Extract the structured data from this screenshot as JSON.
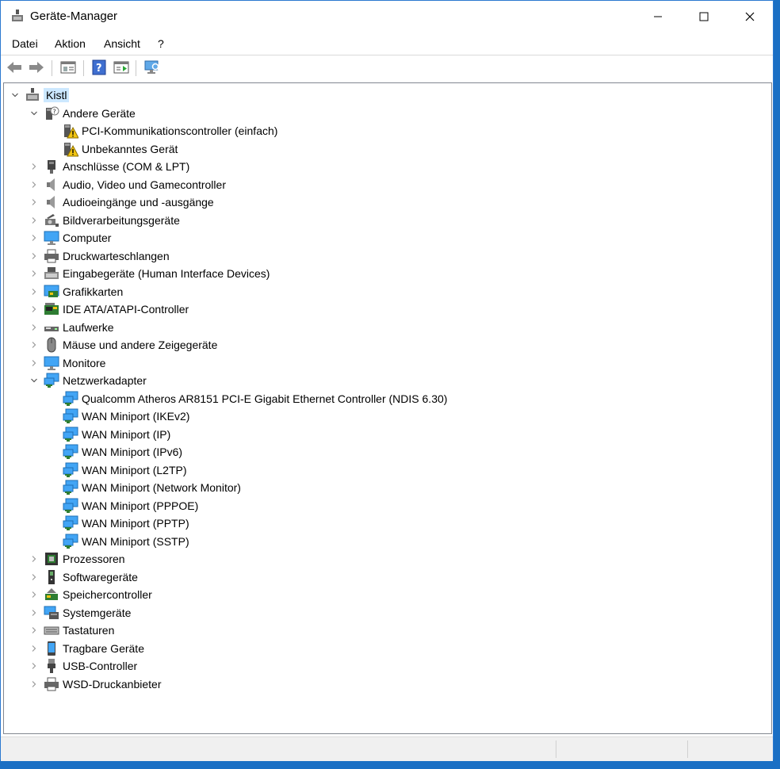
{
  "window": {
    "title": "Geräte-Manager"
  },
  "menu": [
    "Datei",
    "Aktion",
    "Ansicht",
    "?"
  ],
  "tree": {
    "root": "Kistl",
    "categories": [
      {
        "label": "Andere Geräte",
        "icon": "other-devices-icon",
        "expanded": true,
        "children": [
          "PCI-Kommunikationscontroller (einfach)",
          "Unbekanntes Gerät"
        ]
      },
      {
        "label": "Anschlüsse (COM & LPT)",
        "icon": "port-icon"
      },
      {
        "label": "Audio, Video und Gamecontroller",
        "icon": "speaker-icon"
      },
      {
        "label": "Audioeingänge und -ausgänge",
        "icon": "speaker-icon"
      },
      {
        "label": "Bildverarbeitungsgeräte",
        "icon": "camera-icon"
      },
      {
        "label": "Computer",
        "icon": "computer-icon"
      },
      {
        "label": "Druckwarteschlangen",
        "icon": "printer-icon"
      },
      {
        "label": "Eingabegeräte (Human Interface Devices)",
        "icon": "hid-icon"
      },
      {
        "label": "Grafikkarten",
        "icon": "display-adapter-icon"
      },
      {
        "label": "IDE ATA/ATAPI-Controller",
        "icon": "ide-controller-icon"
      },
      {
        "label": "Laufwerke",
        "icon": "disk-drive-icon"
      },
      {
        "label": "Mäuse und andere Zeigegeräte",
        "icon": "mouse-icon"
      },
      {
        "label": "Monitore",
        "icon": "monitor-icon"
      },
      {
        "label": "Netzwerkadapter",
        "icon": "network-adapter-icon",
        "expanded": true,
        "children": [
          "Qualcomm Atheros AR8151 PCI-E Gigabit Ethernet Controller (NDIS 6.30)",
          "WAN Miniport (IKEv2)",
          "WAN Miniport (IP)",
          "WAN Miniport (IPv6)",
          "WAN Miniport (L2TP)",
          "WAN Miniport (Network Monitor)",
          "WAN Miniport (PPPOE)",
          "WAN Miniport (PPTP)",
          "WAN Miniport (SSTP)"
        ]
      },
      {
        "label": "Prozessoren",
        "icon": "processor-icon"
      },
      {
        "label": "Softwaregeräte",
        "icon": "software-device-icon"
      },
      {
        "label": "Speichercontroller",
        "icon": "storage-controller-icon"
      },
      {
        "label": "Systemgeräte",
        "icon": "system-device-icon"
      },
      {
        "label": "Tastaturen",
        "icon": "keyboard-icon"
      },
      {
        "label": "Tragbare Geräte",
        "icon": "portable-device-icon"
      },
      {
        "label": "USB-Controller",
        "icon": "usb-icon"
      },
      {
        "label": "WSD-Druckanbieter",
        "icon": "printer-icon"
      }
    ]
  },
  "colors": {
    "selection": "#cce8ff",
    "accent": "#0078d7",
    "warning": "#f2c511"
  }
}
